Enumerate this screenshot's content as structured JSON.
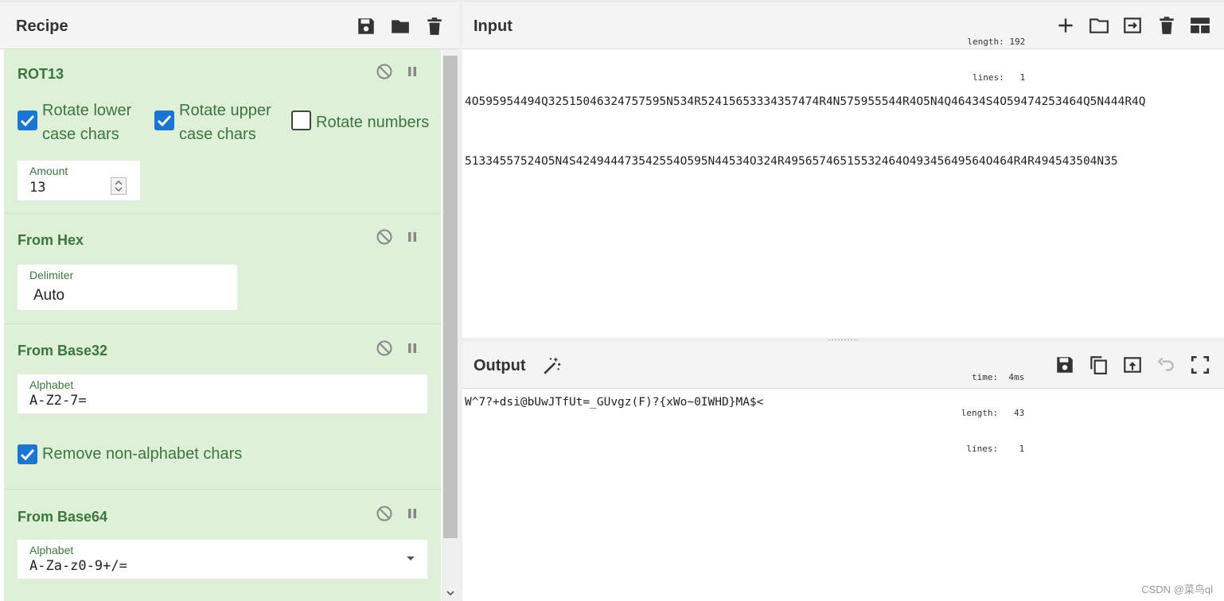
{
  "colors": {
    "accent_green": "#3c763d",
    "recipe_bg": "#dff0d8",
    "checkbox_blue": "#1976d2"
  },
  "recipe": {
    "title": "Recipe",
    "header_icons": [
      "save-icon",
      "folder-icon",
      "trash-icon"
    ],
    "operations": [
      {
        "name": "ROT13",
        "checkboxes": [
          {
            "line1": "Rotate lower",
            "line2": "case chars",
            "checked": true
          },
          {
            "line1": "Rotate upper",
            "line2": "case chars",
            "checked": true
          },
          {
            "line1": "Rotate numbers",
            "checked": false
          }
        ],
        "amount_label": "Amount",
        "amount_value": "13"
      },
      {
        "name": "From Hex",
        "delimiter_label": "Delimiter",
        "delimiter_value": "Auto"
      },
      {
        "name": "From Base32",
        "alphabet_label": "Alphabet",
        "alphabet_value": "A-Z2-7=",
        "remove_label": "Remove non-alphabet chars",
        "remove_checked": true
      },
      {
        "name": "From Base64",
        "alphabet_label": "Alphabet",
        "alphabet_value": "A-Za-z0-9+/="
      }
    ]
  },
  "input": {
    "title": "Input",
    "stats": {
      "length_label": "length:",
      "length": "192",
      "lines_label": "lines:",
      "lines": "1"
    },
    "text_line1": "4O595954494Q32515046324757595N534R52415653334357474R4N575955544R4O5N4Q46434S4O59474253464Q5N444R4Q",
    "text_line2": "51334557524O5N4S424944473542554O595N44534O324R49565746515532464O49345649564O464R4R494543504N35"
  },
  "output": {
    "title": "Output",
    "stats": {
      "time_label": "time:",
      "time": "4ms",
      "length_label": "length:",
      "length": "43",
      "lines_label": "lines:",
      "lines": "1"
    },
    "text": "W^7?+dsi@bUwJTfUt=_GUvgz(F)?{xWo~0IWHD}MA$<"
  },
  "watermark": "CSDN @菜鸟ql"
}
